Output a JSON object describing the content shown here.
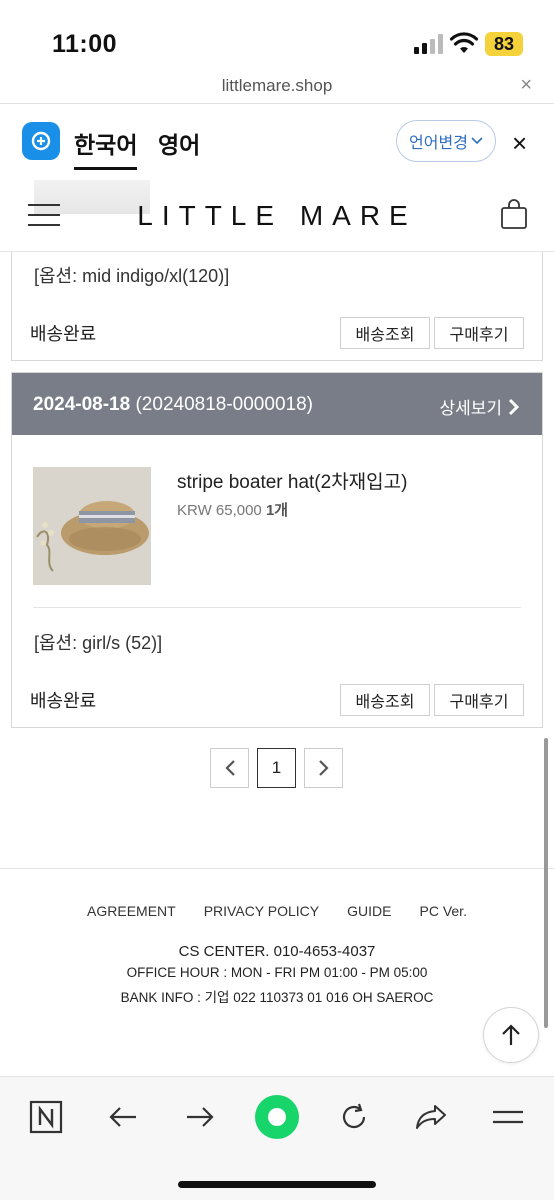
{
  "status_bar": {
    "time": "11:00",
    "battery": "83"
  },
  "url_bar": {
    "domain": "littlemare.shop",
    "close": "×"
  },
  "translate_bar": {
    "source_lang": "한국어",
    "target_lang": "영어",
    "change_label": "언어변경",
    "close": "×"
  },
  "site_header": {
    "brand": "LITTLE MARE"
  },
  "orders": [
    {
      "option": "[옵션: mid indigo/xl(120)]",
      "status": "배송완료",
      "track_label": "배송조회",
      "review_label": "구매후기"
    },
    {
      "date": "2024-08-18",
      "order_no": "(20240818-0000018)",
      "detail_label": "상세보기",
      "product_name": "stripe boater hat(2차재입고)",
      "price": "KRW 65,000",
      "quantity": "1개",
      "option": "[옵션: girl/s (52)]",
      "status": "배송완료",
      "track_label": "배송조회",
      "review_label": "구매후기"
    }
  ],
  "pagination": {
    "current_page": "1"
  },
  "footer": {
    "links": [
      "AGREEMENT",
      "PRIVACY POLICY",
      "GUIDE",
      "PC Ver."
    ],
    "cs_center": "CS CENTER. 010-4653-4037",
    "office_hour": "OFFICE HOUR : MON - FRI PM 01:00 - PM 05:00",
    "bank_info": "BANK INFO : 기업 022 110373 01 016 OH SAEROC"
  },
  "icons": {
    "signal": "signal-icon",
    "wifi": "wifi-icon",
    "menu": "hamburger-menu-icon",
    "bag": "shopping-bag-icon",
    "scroll_top": "arrow-up-icon",
    "tabs": "n-tabs-icon",
    "back": "arrow-left-icon",
    "forward": "arrow-right-icon",
    "home": "green-circle-home-icon",
    "reload": "reload-icon",
    "share": "share-icon",
    "more": "menu-lines-icon"
  },
  "colors": {
    "order_header_bg": "#787d87",
    "accent_green": "#18d56b",
    "translate_blue": "#1a8fe8",
    "battery": "#f4d23b"
  }
}
